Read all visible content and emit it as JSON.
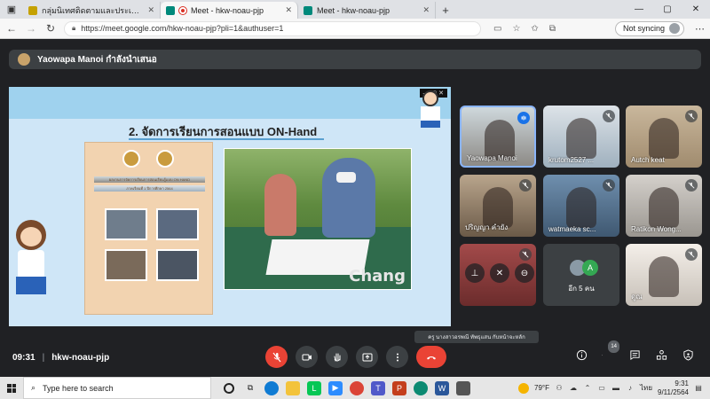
{
  "browser": {
    "tabs": [
      {
        "title": "กลุ่มนิเทศติดตามและประเมินผล - ระ",
        "favicon_color": "#c5a100",
        "active": false
      },
      {
        "title": "Meet - hkw-noau-pjp",
        "favicon_color": "#00897b",
        "active": true
      },
      {
        "title": "Meet - hkw-noau-pjp",
        "favicon_color": "#00897b",
        "active": false
      }
    ],
    "new_tab": "+",
    "url": "https://meet.google.com/hkw-noau-pjp?pli=1&authuser=1",
    "sync_label": "Not syncing"
  },
  "meet": {
    "presenter_text": "Yaowapa Manoi กำลังนำเสนอ",
    "slide": {
      "title": "2. จัดการเรียนการสอนแบบ ON-Hand",
      "poster_line1": "ผลงานการจัดการเรียนการสอนเรียนรู้แบบ ON HAND",
      "poster_line2": "ภาคเรียนที่ 1 ปีการศึกษา 2564",
      "photo_watermark": "Chang"
    },
    "tiles": [
      {
        "name": "Yaowapa Manoi",
        "mic": "active"
      },
      {
        "name": "krutom2527 ...",
        "mic": "muted"
      },
      {
        "name": "Autch keat",
        "mic": "muted"
      },
      {
        "name": "ปริญญา คำยัง",
        "mic": "muted"
      },
      {
        "name": "watmaeka sc...",
        "mic": "muted"
      },
      {
        "name": "Ratikon Wong...",
        "mic": "muted"
      },
      {
        "name": "",
        "mic": "muted"
      },
      {
        "name": "อีก 5 คน",
        "mic": ""
      },
      {
        "name": "ดูณ",
        "mic": "muted"
      }
    ],
    "more_avatar_letter": "A",
    "tooltip": "ครู นางสาวอรพณี ทัพธุแสน กับหน้าจะหลัก",
    "time": "09:31",
    "meeting_code": "hkw-noau-pjp",
    "participant_count": "14",
    "colors": {
      "end_call": "#ea4335",
      "accent": "#8ab4f8"
    }
  },
  "taskbar": {
    "search_placeholder": "Type here to search",
    "temperature": "79°F",
    "language": "ไทย",
    "time": "9:31",
    "date": "9/11/2564"
  }
}
